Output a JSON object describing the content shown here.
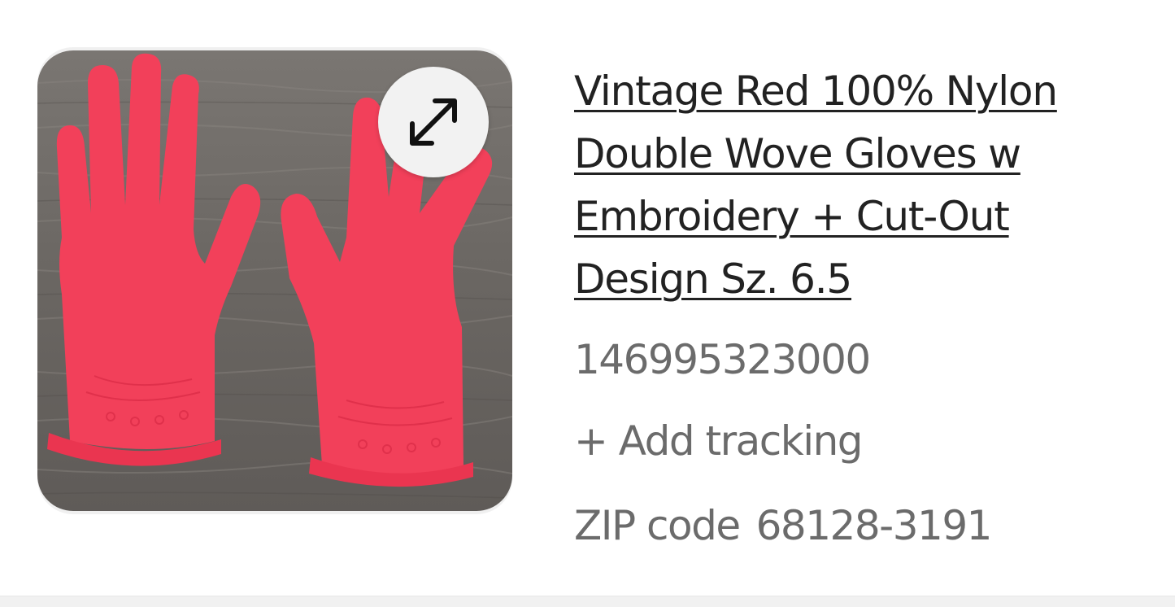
{
  "listing": {
    "title": "Vintage Red 100% Nylon Double Wove Gloves w Embroidery + Cut-Out Design Sz. 6.5",
    "image_alt": "Red nylon gloves on wooden surface",
    "expand_icon": "expand-arrows-icon"
  },
  "order": {
    "number": "146995323000",
    "add_tracking_label": "+ Add tracking",
    "zip_label": "ZIP code",
    "zip_value": "68128-3191"
  },
  "colors": {
    "glove_red": "#f2405a",
    "wood_gray": "#6e6a66",
    "muted_text": "#6b6b6b",
    "title_text": "#222222"
  }
}
